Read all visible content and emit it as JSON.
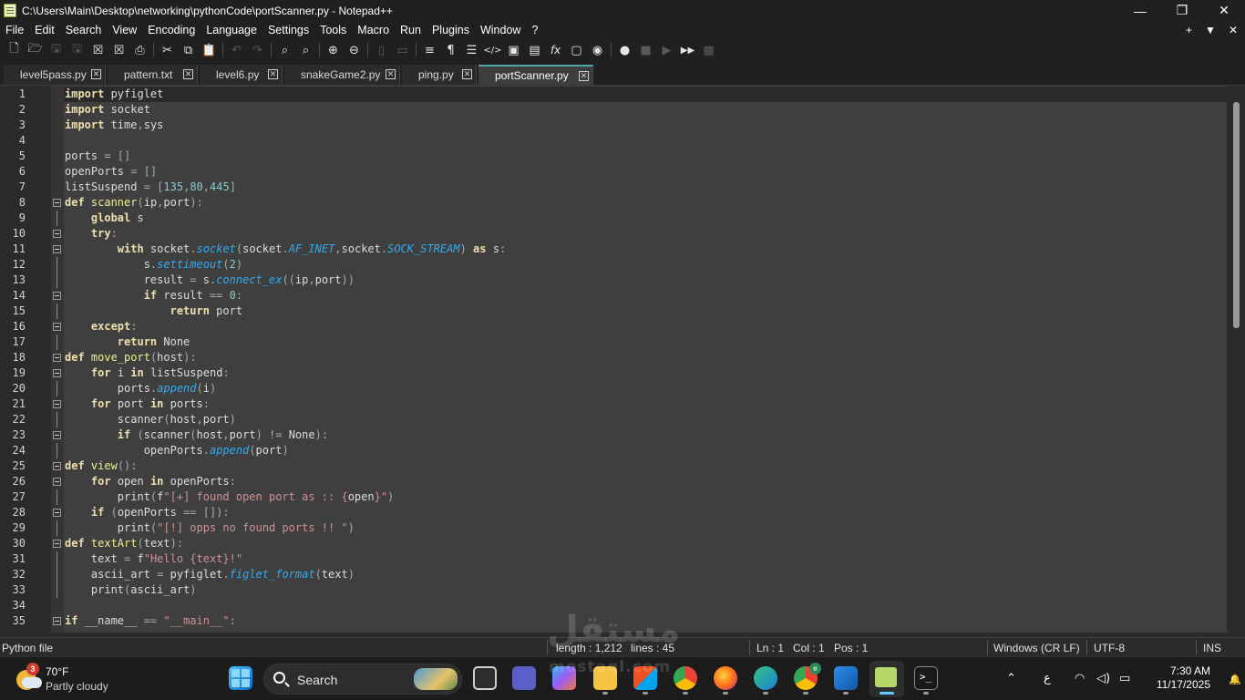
{
  "window": {
    "title": "C:\\Users\\Main\\Desktop\\networking\\pythonCode\\portScanner.py - Notepad++",
    "minimize_icon": "minimize-icon",
    "maximize_icon": "restore-icon",
    "close_icon": "close-icon"
  },
  "menu": {
    "items": [
      "File",
      "Edit",
      "Search",
      "View",
      "Encoding",
      "Language",
      "Settings",
      "Tools",
      "Macro",
      "Run",
      "Plugins",
      "Window",
      "?"
    ],
    "right": [
      "+",
      "▼",
      "✕"
    ]
  },
  "toolbar": {
    "icons": [
      "new-file-icon",
      "open-file-icon",
      "save-icon",
      "save-all-icon",
      "close-icon",
      "close-all-icon",
      "print-icon",
      "cut-icon",
      "copy-icon",
      "paste-icon",
      "undo-icon",
      "redo-icon",
      "find-icon",
      "replace-icon",
      "zoom-in-icon",
      "zoom-out-icon",
      "sync-vertical-icon",
      "sync-horizontal-icon",
      "word-wrap-icon",
      "show-all-chars-icon",
      "indent-guide-icon",
      "xml-tag-icon",
      "document-map-icon",
      "function-list-icon",
      "fx-icon",
      "folder-workspace-icon",
      "monitoring-icon",
      "record-macro-icon",
      "stop-macro-icon",
      "play-macro-icon",
      "run-multiple-macro-icon",
      "save-macro-icon"
    ]
  },
  "tabs": [
    {
      "label": "level5pass.py",
      "active": false
    },
    {
      "label": "pattern.txt",
      "active": false
    },
    {
      "label": "level6.py",
      "active": false
    },
    {
      "label": "snakeGame2.py",
      "active": false
    },
    {
      "label": "ping.py",
      "active": false
    },
    {
      "label": "portScanner.py",
      "active": true
    }
  ],
  "editor": {
    "current_line": 1,
    "lines": [
      {
        "n": "1",
        "fold": "",
        "code": [
          [
            "kw",
            "import"
          ],
          [
            "",
            " pyfiglet"
          ]
        ]
      },
      {
        "n": "2",
        "fold": "",
        "code": [
          [
            "kw",
            "import"
          ],
          [
            "",
            " socket"
          ]
        ]
      },
      {
        "n": "3",
        "fold": "",
        "code": [
          [
            "kw",
            "import"
          ],
          [
            "",
            " time"
          ],
          [
            "op",
            ","
          ],
          [
            "",
            "sys"
          ]
        ]
      },
      {
        "n": "4",
        "fold": "",
        "code": []
      },
      {
        "n": "5",
        "fold": "",
        "code": [
          [
            "",
            "ports "
          ],
          [
            "op",
            "= []"
          ]
        ]
      },
      {
        "n": "6",
        "fold": "",
        "code": [
          [
            "",
            "openPorts "
          ],
          [
            "op",
            "= []"
          ]
        ]
      },
      {
        "n": "7",
        "fold": "",
        "code": [
          [
            "",
            "listSuspend "
          ],
          [
            "op",
            "= ["
          ],
          [
            "nm",
            "135"
          ],
          [
            "op",
            ","
          ],
          [
            "nm",
            "80"
          ],
          [
            "op",
            ","
          ],
          [
            "nm",
            "445"
          ],
          [
            "op",
            "]"
          ]
        ]
      },
      {
        "n": "8",
        "fold": "box",
        "code": [
          [
            "kw",
            "def"
          ],
          [
            "fn",
            " scanner"
          ],
          [
            "op",
            "("
          ],
          [
            "",
            "ip"
          ],
          [
            "op",
            ","
          ],
          [
            "",
            "port"
          ],
          [
            "op",
            "):"
          ]
        ]
      },
      {
        "n": "9",
        "fold": "",
        "code": [
          [
            "",
            "    "
          ],
          [
            "kw",
            "global"
          ],
          [
            "",
            " s"
          ]
        ]
      },
      {
        "n": "10",
        "fold": "box",
        "code": [
          [
            "",
            "    "
          ],
          [
            "kw",
            "try"
          ],
          [
            "op",
            ":"
          ]
        ]
      },
      {
        "n": "11",
        "fold": "box",
        "code": [
          [
            "",
            "        "
          ],
          [
            "kw",
            "with"
          ],
          [
            "",
            " socket"
          ],
          [
            "op",
            "."
          ],
          [
            "it",
            "socket"
          ],
          [
            "op",
            "("
          ],
          [
            "",
            "socket"
          ],
          [
            "op",
            "."
          ],
          [
            "it",
            "AF_INET"
          ],
          [
            "op",
            ","
          ],
          [
            "",
            "socket"
          ],
          [
            "op",
            "."
          ],
          [
            "it",
            "SOCK_STREAM"
          ],
          [
            "op",
            ") "
          ],
          [
            "kw",
            "as"
          ],
          [
            "",
            " s"
          ],
          [
            "op",
            ":"
          ]
        ]
      },
      {
        "n": "12",
        "fold": "",
        "code": [
          [
            "",
            "            s"
          ],
          [
            "op",
            "."
          ],
          [
            "it",
            "settimeout"
          ],
          [
            "op",
            "("
          ],
          [
            "nm",
            "2"
          ],
          [
            "op",
            ")"
          ]
        ]
      },
      {
        "n": "13",
        "fold": "",
        "code": [
          [
            "",
            "            result "
          ],
          [
            "op",
            "= "
          ],
          [
            "",
            "s"
          ],
          [
            "op",
            "."
          ],
          [
            "it",
            "connect_ex"
          ],
          [
            "op",
            "(("
          ],
          [
            "",
            "ip"
          ],
          [
            "op",
            ","
          ],
          [
            "",
            "port"
          ],
          [
            "op",
            "))"
          ]
        ]
      },
      {
        "n": "14",
        "fold": "box",
        "code": [
          [
            "",
            "            "
          ],
          [
            "kw",
            "if"
          ],
          [
            "",
            " result "
          ],
          [
            "op",
            "== "
          ],
          [
            "nm",
            "0"
          ],
          [
            "op",
            ":"
          ]
        ]
      },
      {
        "n": "15",
        "fold": "",
        "code": [
          [
            "",
            "                "
          ],
          [
            "kw",
            "return"
          ],
          [
            "",
            " port"
          ]
        ]
      },
      {
        "n": "16",
        "fold": "box",
        "code": [
          [
            "",
            "    "
          ],
          [
            "kw",
            "except"
          ],
          [
            "op",
            ":"
          ]
        ]
      },
      {
        "n": "17",
        "fold": "",
        "code": [
          [
            "",
            "        "
          ],
          [
            "kw",
            "return"
          ],
          [
            "",
            " None"
          ]
        ]
      },
      {
        "n": "18",
        "fold": "box",
        "code": [
          [
            "kw",
            "def"
          ],
          [
            "fn",
            " move_port"
          ],
          [
            "op",
            "("
          ],
          [
            "",
            "host"
          ],
          [
            "op",
            "):"
          ]
        ]
      },
      {
        "n": "19",
        "fold": "box",
        "code": [
          [
            "",
            "    "
          ],
          [
            "kw",
            "for"
          ],
          [
            "",
            " i "
          ],
          [
            "kw",
            "in"
          ],
          [
            "",
            " listSuspend"
          ],
          [
            "op",
            ":"
          ]
        ]
      },
      {
        "n": "20",
        "fold": "",
        "code": [
          [
            "",
            "        ports"
          ],
          [
            "op",
            "."
          ],
          [
            "it",
            "append"
          ],
          [
            "op",
            "("
          ],
          [
            "",
            "i"
          ],
          [
            "op",
            ")"
          ]
        ]
      },
      {
        "n": "21",
        "fold": "box",
        "code": [
          [
            "",
            "    "
          ],
          [
            "kw",
            "for"
          ],
          [
            "",
            " port "
          ],
          [
            "kw",
            "in"
          ],
          [
            "",
            " ports"
          ],
          [
            "op",
            ":"
          ]
        ]
      },
      {
        "n": "22",
        "fold": "",
        "code": [
          [
            "",
            "        scanner"
          ],
          [
            "op",
            "("
          ],
          [
            "",
            "host"
          ],
          [
            "op",
            ","
          ],
          [
            "",
            "port"
          ],
          [
            "op",
            ")"
          ]
        ]
      },
      {
        "n": "23",
        "fold": "box",
        "code": [
          [
            "",
            "        "
          ],
          [
            "kw",
            "if"
          ],
          [
            "op",
            " ("
          ],
          [
            "",
            "scanner"
          ],
          [
            "op",
            "("
          ],
          [
            "",
            "host"
          ],
          [
            "op",
            ","
          ],
          [
            "",
            "port"
          ],
          [
            "op",
            ") != "
          ],
          [
            "",
            "None"
          ],
          [
            "op",
            "):"
          ]
        ]
      },
      {
        "n": "24",
        "fold": "",
        "code": [
          [
            "",
            "            openPorts"
          ],
          [
            "op",
            "."
          ],
          [
            "it",
            "append"
          ],
          [
            "op",
            "("
          ],
          [
            "",
            "port"
          ],
          [
            "op",
            ")"
          ]
        ]
      },
      {
        "n": "25",
        "fold": "box",
        "code": [
          [
            "kw",
            "def"
          ],
          [
            "fn",
            " view"
          ],
          [
            "op",
            "():"
          ]
        ]
      },
      {
        "n": "26",
        "fold": "box",
        "code": [
          [
            "",
            "    "
          ],
          [
            "kw",
            "for"
          ],
          [
            "",
            " open "
          ],
          [
            "kw",
            "in"
          ],
          [
            "",
            " openPorts"
          ],
          [
            "op",
            ":"
          ]
        ]
      },
      {
        "n": "27",
        "fold": "",
        "code": [
          [
            "",
            "        print"
          ],
          [
            "op",
            "("
          ],
          [
            "",
            "f"
          ],
          [
            "st",
            "\"[+] found open port as :: {"
          ],
          [
            "",
            "open"
          ],
          [
            "st",
            "}\""
          ],
          [
            "op",
            ")"
          ]
        ]
      },
      {
        "n": "28",
        "fold": "box",
        "code": [
          [
            "",
            "    "
          ],
          [
            "kw",
            "if"
          ],
          [
            "op",
            " ("
          ],
          [
            "",
            "openPorts "
          ],
          [
            "op",
            "== []):"
          ]
        ]
      },
      {
        "n": "29",
        "fold": "",
        "code": [
          [
            "",
            "        print"
          ],
          [
            "op",
            "("
          ],
          [
            "st",
            "\"[!] opps no found ports !! \""
          ],
          [
            "op",
            ")"
          ]
        ]
      },
      {
        "n": "30",
        "fold": "box",
        "code": [
          [
            "kw",
            "def"
          ],
          [
            "fn",
            " textArt"
          ],
          [
            "op",
            "("
          ],
          [
            "",
            "text"
          ],
          [
            "op",
            "):"
          ]
        ]
      },
      {
        "n": "31",
        "fold": "",
        "code": [
          [
            "",
            "    text "
          ],
          [
            "op",
            "= "
          ],
          [
            "",
            "f"
          ],
          [
            "st",
            "\"Hello {text}!\""
          ]
        ]
      },
      {
        "n": "32",
        "fold": "",
        "code": [
          [
            "",
            "    ascii_art "
          ],
          [
            "op",
            "= "
          ],
          [
            "",
            "pyfiglet"
          ],
          [
            "op",
            "."
          ],
          [
            "it",
            "figlet_format"
          ],
          [
            "op",
            "("
          ],
          [
            "",
            "text"
          ],
          [
            "op",
            ")"
          ]
        ]
      },
      {
        "n": "33",
        "fold": "",
        "code": [
          [
            "",
            "    print"
          ],
          [
            "op",
            "("
          ],
          [
            "",
            "ascii_art"
          ],
          [
            "op",
            ")"
          ]
        ]
      },
      {
        "n": "34",
        "fold": "",
        "code": []
      },
      {
        "n": "35",
        "fold": "box",
        "code": [
          [
            "kw",
            "if"
          ],
          [
            "",
            " __name__ "
          ],
          [
            "op",
            "== "
          ],
          [
            "st",
            "\"__main__\""
          ],
          [
            "op",
            ":"
          ]
        ]
      }
    ]
  },
  "status": {
    "file_type": "Python file",
    "length": "length : 1,212",
    "lines": "lines : 45",
    "ln": "Ln : 1",
    "col": "Col : 1",
    "pos": "Pos : 1",
    "eol": "Windows (CR LF)",
    "encoding": "UTF-8",
    "mode": "INS"
  },
  "taskbar": {
    "weather_badge": "3",
    "weather_temp": "70°F",
    "weather_cond": "Partly cloudy",
    "search_placeholder": "Search",
    "time": "7:30 AM",
    "date": "11/17/2025",
    "lang": "ع",
    "chrome_badge": "e",
    "apps": [
      "start-icon",
      "search-icon",
      "widget-photo-icon",
      "task-view-icon",
      "chat-icon",
      "copilot-icon",
      "file-explorer-icon",
      "store-icon",
      "chrome-icon",
      "firefox-icon",
      "edge-icon",
      "chrome-profile-icon",
      "paint-icon",
      "notepadpp-icon",
      "terminal-icon"
    ]
  },
  "watermark": {
    "main": "مستقل",
    "sub": "mostaql.com"
  }
}
